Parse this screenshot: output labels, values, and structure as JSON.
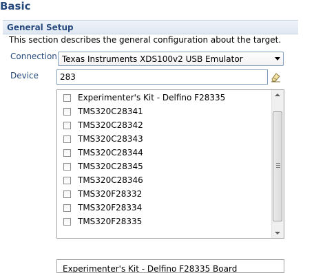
{
  "page": {
    "title": "Basic"
  },
  "section": {
    "title": "General Setup",
    "description": "This section describes the general configuration about the target."
  },
  "connection": {
    "label": "Connection",
    "value": "Texas Instruments XDS100v2 USB Emulator"
  },
  "device": {
    "label": "Device",
    "filter_value": "283",
    "clear_icon": "eraser-icon",
    "items": [
      {
        "label": "Experimenter's Kit - Delfino F28335",
        "checked": false
      },
      {
        "label": "TMS320C28341",
        "checked": false
      },
      {
        "label": "TMS320C28342",
        "checked": false
      },
      {
        "label": "TMS320C28343",
        "checked": false
      },
      {
        "label": "TMS320C28344",
        "checked": false
      },
      {
        "label": "TMS320C28345",
        "checked": false
      },
      {
        "label": "TMS320C28346",
        "checked": false
      },
      {
        "label": "TMS320F28332",
        "checked": false
      },
      {
        "label": "TMS320F28334",
        "checked": false
      },
      {
        "label": "TMS320F28335",
        "checked": false
      }
    ],
    "description_partial": "Experimenter's Kit - Delfino F28335 Board"
  },
  "colors": {
    "heading": "#274a7e",
    "header_band": "#dfe7f2",
    "input_border": "#7f9db9"
  }
}
